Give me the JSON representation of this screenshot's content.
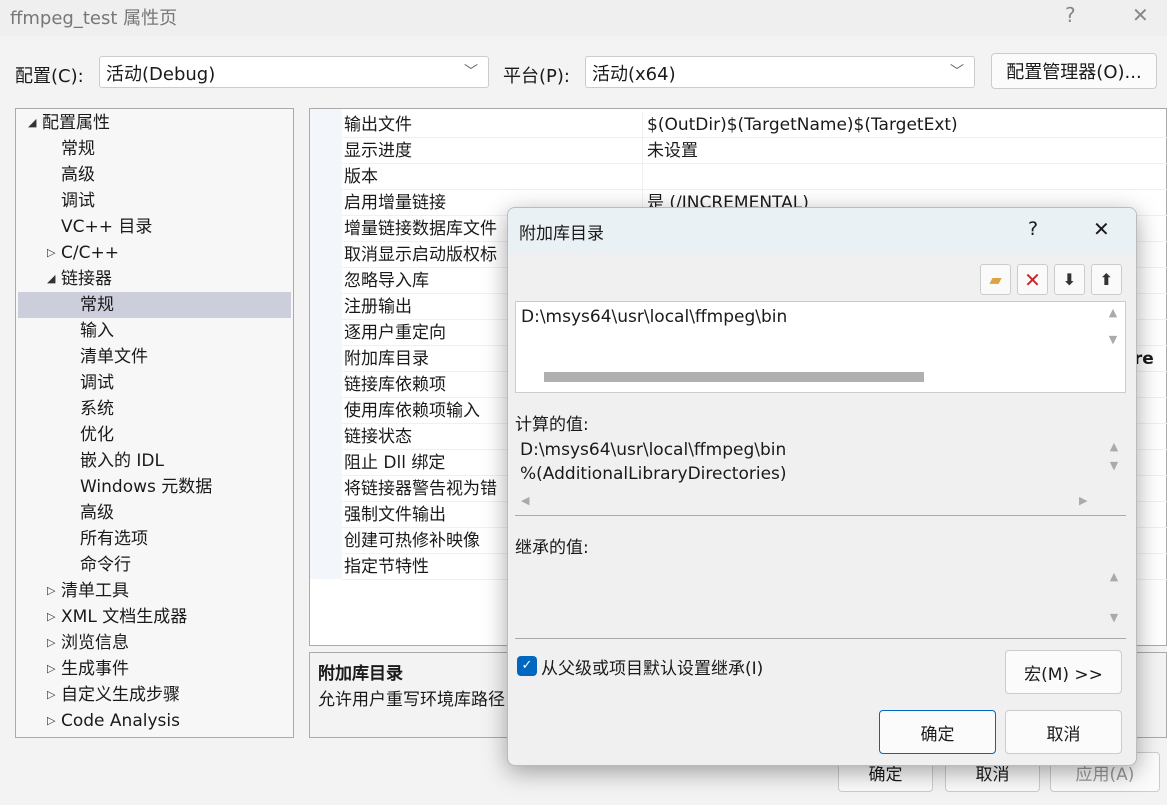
{
  "window": {
    "title": "ffmpeg_test 属性页",
    "help": "?",
    "close": "✕"
  },
  "config": {
    "label": "配置(C):",
    "value": "活动(Debug)"
  },
  "platform": {
    "label": "平台(P):",
    "value": "活动(x64)"
  },
  "config_manager": "配置管理器(O)...",
  "tree": [
    {
      "label": "配置属性",
      "level": 0,
      "toggle": "expanded"
    },
    {
      "label": "常规",
      "level": 1
    },
    {
      "label": "高级",
      "level": 1
    },
    {
      "label": "调试",
      "level": 1
    },
    {
      "label": "VC++ 目录",
      "level": 1
    },
    {
      "label": "C/C++",
      "level": 1,
      "toggle": "collapsed"
    },
    {
      "label": "链接器",
      "level": 1,
      "toggle": "expanded"
    },
    {
      "label": "常规",
      "level": 2,
      "selected": true
    },
    {
      "label": "输入",
      "level": 2
    },
    {
      "label": "清单文件",
      "level": 2
    },
    {
      "label": "调试",
      "level": 2
    },
    {
      "label": "系统",
      "level": 2
    },
    {
      "label": "优化",
      "level": 2
    },
    {
      "label": "嵌入的 IDL",
      "level": 2
    },
    {
      "label": "Windows 元数据",
      "level": 2
    },
    {
      "label": "高级",
      "level": 2
    },
    {
      "label": "所有选项",
      "level": 2
    },
    {
      "label": "命令行",
      "level": 2
    },
    {
      "label": "清单工具",
      "level": 1,
      "toggle": "collapsed"
    },
    {
      "label": "XML 文档生成器",
      "level": 1,
      "toggle": "collapsed"
    },
    {
      "label": "浏览信息",
      "level": 1,
      "toggle": "collapsed"
    },
    {
      "label": "生成事件",
      "level": 1,
      "toggle": "collapsed"
    },
    {
      "label": "自定义生成步骤",
      "level": 1,
      "toggle": "collapsed"
    },
    {
      "label": "Code Analysis",
      "level": 1,
      "toggle": "collapsed"
    }
  ],
  "properties": [
    {
      "name": "输出文件",
      "value": "$(OutDir)$(TargetName)$(TargetExt)"
    },
    {
      "name": "显示进度",
      "value": "未设置"
    },
    {
      "name": "版本",
      "value": ""
    },
    {
      "name": "启用增量链接",
      "value": "是 (/INCREMENTAL)"
    },
    {
      "name": "增量链接数据库文件"
    },
    {
      "name": "取消显示启动版权标"
    },
    {
      "name": "忽略导入库"
    },
    {
      "name": "注册输出"
    },
    {
      "name": "逐用户重定向"
    },
    {
      "name": "附加库目录"
    },
    {
      "name": "链接库依赖项"
    },
    {
      "name": "使用库依赖项输入"
    },
    {
      "name": "链接状态"
    },
    {
      "name": "阻止 Dll 绑定"
    },
    {
      "name": "将链接器警告视为错"
    },
    {
      "name": "强制文件输出"
    },
    {
      "name": "创建可热修补映像"
    },
    {
      "name": "指定节特性"
    }
  ],
  "partial_value": "ire",
  "description": {
    "title": "附加库目录",
    "text": "允许用户重写环境库路径"
  },
  "bg_buttons": {
    "ok": "确定",
    "cancel": "取消",
    "apply": "应用(A)"
  },
  "dialog": {
    "title": "附加库目录",
    "help": "?",
    "close": "✕",
    "toolbar": {
      "new": "new-folder-icon",
      "delete": "delete-icon",
      "down": "move-down-icon",
      "up": "move-up-icon"
    },
    "entries": [
      "D:\\msys64\\usr\\local\\ffmpeg\\bin"
    ],
    "computed_label": "计算的值:",
    "computed": [
      "D:\\msys64\\usr\\local\\ffmpeg\\bin",
      "%(AdditionalLibraryDirectories)"
    ],
    "inherited_label": "继承的值:",
    "inherit_checkbox": {
      "label": "从父级或项目默认设置继承(I)",
      "checked": true
    },
    "macro": "宏(M) >>",
    "ok": "确定",
    "cancel": "取消"
  },
  "colors": {
    "accent": "#0067c0",
    "selected": "#cccedb"
  }
}
